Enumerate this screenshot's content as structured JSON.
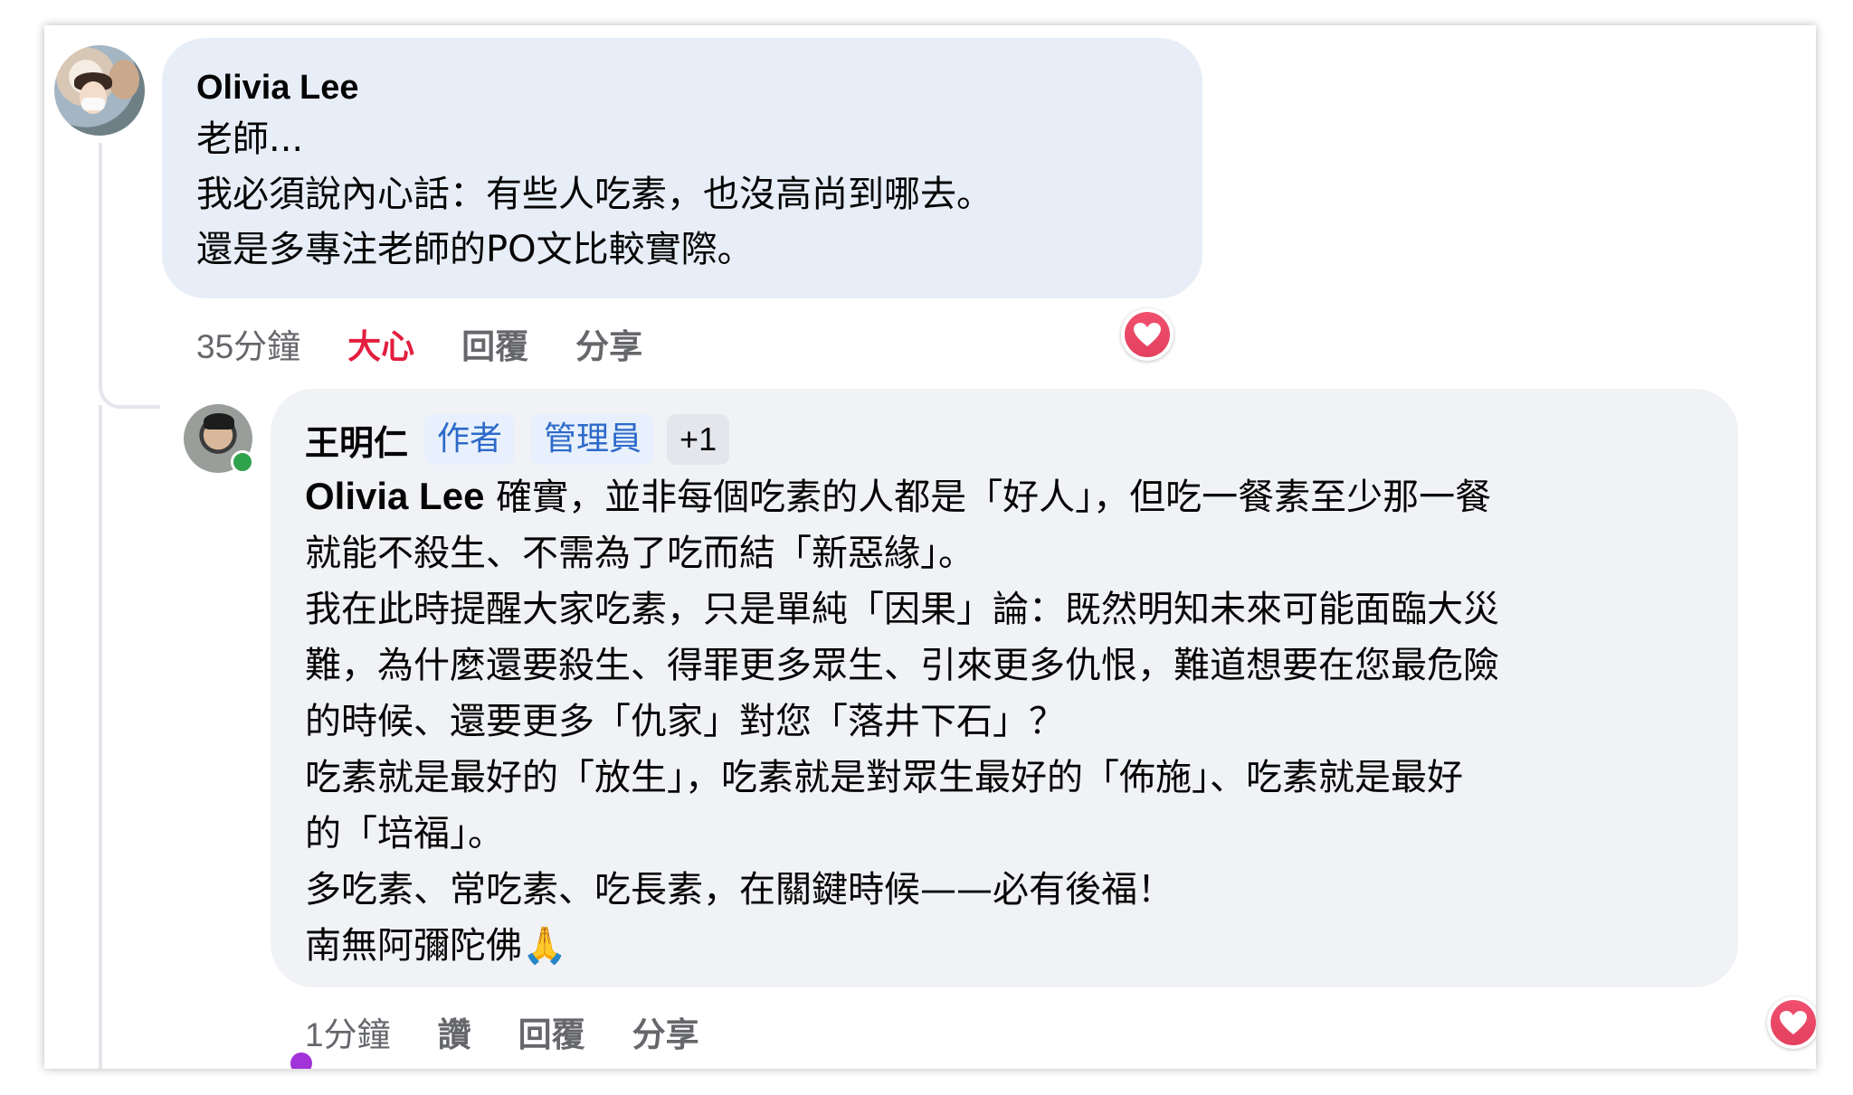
{
  "comment": {
    "author": "Olivia Lee",
    "lines": [
      "老師...",
      "我必須說內心話：有些人吃素，也沒高尚到哪去。",
      "還是多專注老師的PO文比較實際。"
    ],
    "time": "35分鐘",
    "actions": {
      "love": "大心",
      "reply": "回覆",
      "share": "分享"
    },
    "reaction_icon": "heart-icon",
    "reaction_color": "#e4405f"
  },
  "reply": {
    "author": "王明仁",
    "badges": {
      "author": "作者",
      "admin": "管理員",
      "more": "+1"
    },
    "online": true,
    "mention": "Olivia Lee",
    "text": " 確實，並非每個吃素的人都是「好人」，但吃一餐素至少那一餐\n就能不殺生、不需為了吃而結「新惡緣」。\n我在此時提醒大家吃素，只是單純「因果」論：既然明知未來可能面臨大災\n難，為什麼還要殺生、得罪更多眾生、引來更多仇恨，難道想要在您最危險\n的時候、還要更多「仇家」對您「落井下石」？\n吃素就是最好的「放生」，吃素就是對眾生最好的「佈施」、吃素就是最好\n的「培福」。\n多吃素、常吃素、吃長素，在關鍵時候——必有後福！\n南無阿彌陀佛🙏",
    "time": "1分鐘",
    "actions": {
      "like": "讚",
      "reply": "回覆",
      "share": "分享"
    },
    "reaction_icon": "heart-icon"
  },
  "colors": {
    "love_red": "#e41e3f",
    "badge_blue": "#2d6ac9",
    "online_green": "#31a24c",
    "muted_text": "#65676b"
  }
}
